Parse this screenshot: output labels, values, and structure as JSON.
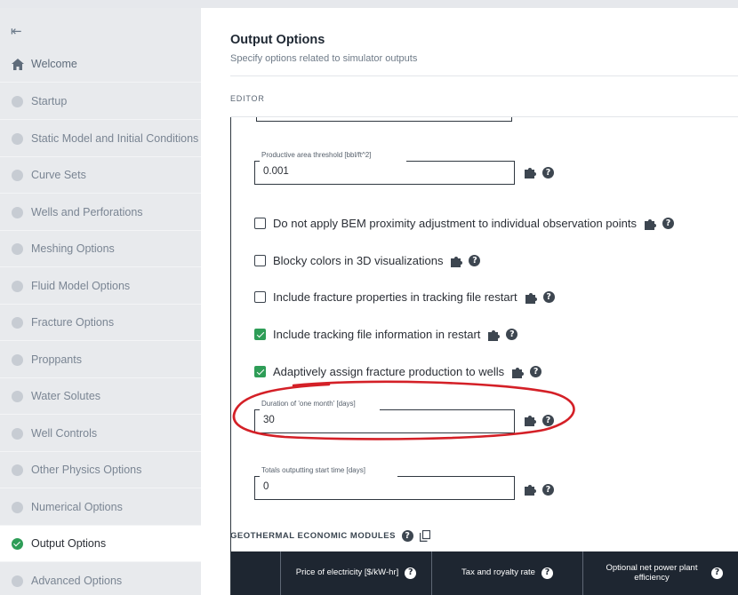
{
  "sidebar": {
    "collapse_icon": "collapse-left-icon",
    "items": [
      {
        "label": "Welcome",
        "state": "home"
      },
      {
        "label": "Startup",
        "state": "pending"
      },
      {
        "label": "Static Model and Initial Conditions",
        "state": "pending"
      },
      {
        "label": "Curve Sets",
        "state": "pending"
      },
      {
        "label": "Wells and Perforations",
        "state": "pending"
      },
      {
        "label": "Meshing Options",
        "state": "pending"
      },
      {
        "label": "Fluid Model Options",
        "state": "pending"
      },
      {
        "label": "Fracture Options",
        "state": "pending"
      },
      {
        "label": "Proppants",
        "state": "pending"
      },
      {
        "label": "Water Solutes",
        "state": "pending"
      },
      {
        "label": "Well Controls",
        "state": "pending"
      },
      {
        "label": "Other Physics Options",
        "state": "pending"
      },
      {
        "label": "Numerical Options",
        "state": "pending"
      },
      {
        "label": "Output Options",
        "state": "active-complete"
      },
      {
        "label": "Advanced Options",
        "state": "pending"
      }
    ]
  },
  "header": {
    "title": "Output Options",
    "subtitle": "Specify options related to simulator outputs"
  },
  "editor": {
    "label": "EDITOR",
    "productive_area": {
      "label": "Productive area threshold [bbl/ft^2]",
      "value": "0.001"
    },
    "checkboxes": [
      {
        "label": "Do not apply BEM proximity adjustment to individual observation points",
        "checked": false
      },
      {
        "label": "Blocky colors in 3D visualizations",
        "checked": false
      },
      {
        "label": "Include fracture properties in tracking file restart",
        "checked": false
      },
      {
        "label": "Include tracking file information in restart",
        "checked": true
      },
      {
        "label": "Adaptively assign fracture production to wells",
        "checked": true
      }
    ],
    "one_month": {
      "label": "Duration of 'one month' [days]",
      "value": "30"
    },
    "totals_start": {
      "label": "Totals outputting start time [days]",
      "value": "0"
    }
  },
  "geothermal": {
    "title": "GEOTHERMAL ECONOMIC MODULES",
    "columns": [
      {
        "label": "",
        "help": false
      },
      {
        "label": "Price of electricity [$/kW-hr]",
        "help": true
      },
      {
        "label": "Tax and royalty rate",
        "help": true
      },
      {
        "label": "Optional net power plant efficiency",
        "help": true
      }
    ]
  },
  "colors": {
    "accent_green": "#2e9d57",
    "annotation_red": "#d42027",
    "table_header": "#1e2631"
  }
}
